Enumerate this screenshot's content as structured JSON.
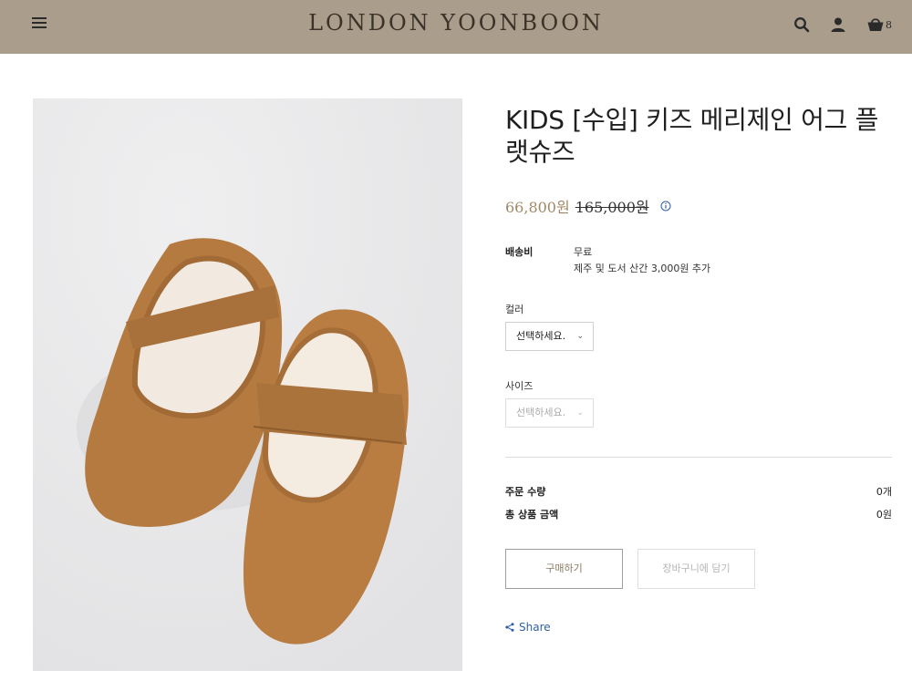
{
  "header": {
    "logo": "LONDON YOONBOON",
    "cart_count": "8",
    "bg_color": "#aa9d8b"
  },
  "product": {
    "title": "KIDS [수입] 키즈 메리제인 어그 플랫슈즈",
    "sale_price": "66,800원",
    "original_price": "165,000원"
  },
  "shipping": {
    "label": "배송비",
    "value": "무료",
    "note": "제주 및 도서 산간 3,000원 추가"
  },
  "options": {
    "color_label": "컬러",
    "color_select": "선택하세요.",
    "size_label": "사이즈",
    "size_select": "선택하세요."
  },
  "summary": {
    "qty_label": "주문 수량",
    "qty_value": "0개",
    "total_label": "총 상품 금액",
    "total_value": "0원"
  },
  "buttons": {
    "buy": "구매하기",
    "cart": "장바구니에 담기"
  },
  "share": {
    "label": "Share"
  },
  "icons": [
    "menu-icon",
    "search-icon",
    "user-icon",
    "cart-icon",
    "info-icon",
    "share-icon",
    "chevron-down-icon"
  ]
}
